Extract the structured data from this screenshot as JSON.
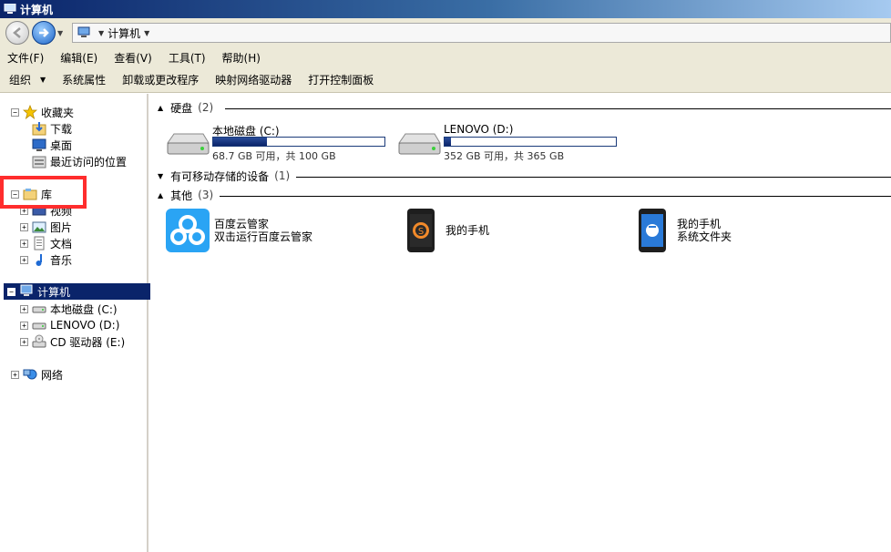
{
  "window": {
    "title": "计算机"
  },
  "address": {
    "path": "计算机"
  },
  "menubar": {
    "items": [
      "文件(F)",
      "编辑(E)",
      "查看(V)",
      "工具(T)",
      "帮助(H)"
    ]
  },
  "toolbar": {
    "organize": "组织",
    "system_props": "系统属性",
    "uninstall": "卸载或更改程序",
    "map_drive": "映射网络驱动器",
    "control_panel": "打开控制面板"
  },
  "nav": {
    "favorites": "收藏夹",
    "downloads": "下载",
    "desktop": "桌面",
    "recent": "最近访问的位置",
    "libraries": "库",
    "videos": "视频",
    "pictures": "图片",
    "documents": "文档",
    "music": "音乐",
    "computer": "计算机",
    "drive_c": "本地磁盘 (C:)",
    "drive_d": "LENOVO (D:)",
    "drive_e": "CD 驱动器 (E:)",
    "network": "网络"
  },
  "main": {
    "groups": {
      "hdd": {
        "title": "硬盘",
        "count": "(2)"
      },
      "removable": {
        "title": "有可移动存储的设备",
        "count": "(1)"
      },
      "other": {
        "title": "其他",
        "count": "(3)"
      }
    },
    "drives": [
      {
        "name": "本地磁盘 (C:)",
        "stat": "68.7 GB 可用，共 100 GB",
        "used_fraction": 0.313
      },
      {
        "name": "LENOVO (D:)",
        "stat": "352 GB 可用，共 365 GB",
        "used_fraction": 0.036
      }
    ],
    "others": [
      {
        "line1": "百度云管家",
        "line2": "双击运行百度云管家"
      },
      {
        "line1": "我的手机",
        "line2": ""
      },
      {
        "line1": "我的手机",
        "line2": "系统文件夹"
      }
    ]
  },
  "colors": {
    "selection": "#0a246a",
    "highlight_box": "#ff2d2d",
    "baidu_blue": "#2aa4f4"
  }
}
